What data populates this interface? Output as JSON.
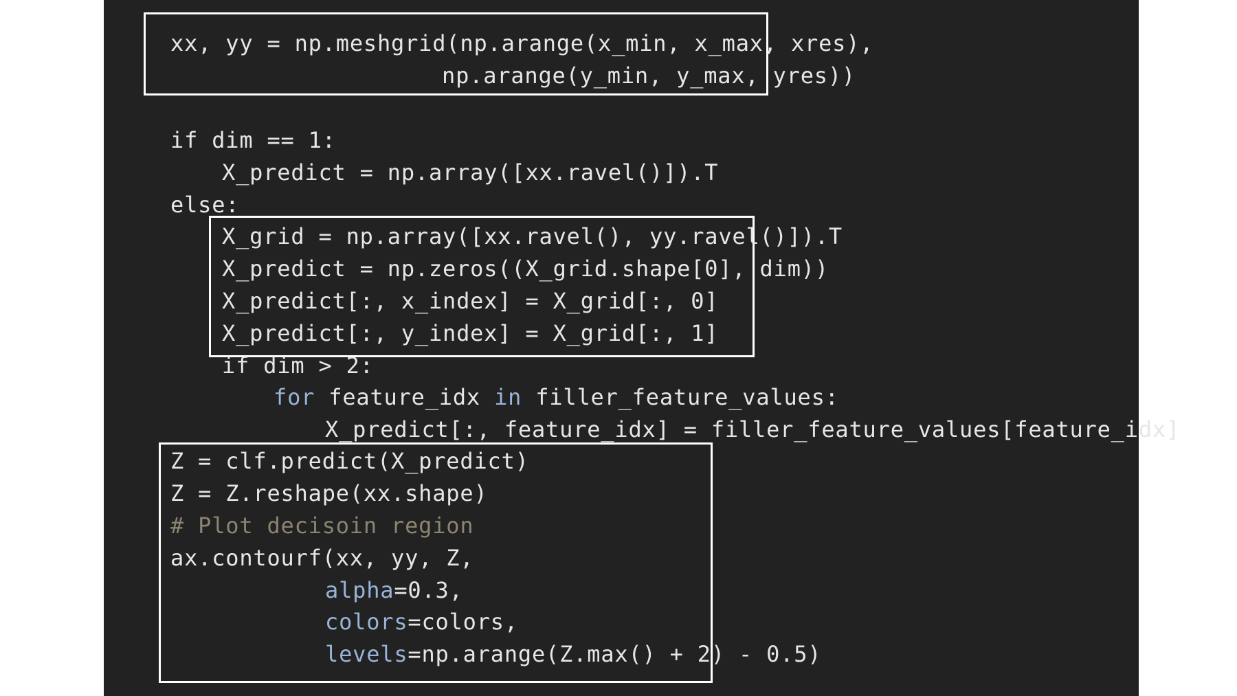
{
  "colors": {
    "background": "#222222",
    "text": "#e6e6e6",
    "keyword": "#98b4d8",
    "comment": "#8a8470",
    "box_border": "#ffffff",
    "page": "#ffffff"
  },
  "code": {
    "line_1": "xx, yy = np.meshgrid(np.arange(x_min, x_max, xres),",
    "line_2": "np.arange(y_min, y_max, yres))",
    "line_3": {
      "a": "if dim == 1:"
    },
    "line_4": "X_predict = np.array([xx.ravel()]).T",
    "line_5": "else:",
    "line_6": "X_grid = np.array([xx.ravel(), yy.ravel()]).T",
    "line_7": "X_predict = np.zeros((X_grid.shape[0], dim))",
    "line_8": "X_predict[:, x_index] = X_grid[:, 0]",
    "line_9": "X_predict[:, y_index] = X_grid[:, 1]",
    "line_10": "if dim > 2:",
    "line_11": {
      "kw_for": "for",
      "var": " feature_idx ",
      "kw_in": "in",
      "rest": " filler_feature_values:"
    },
    "line_12": "X_predict[:, feature_idx] = filler_feature_values[feature_idx]",
    "line_13": "Z = clf.predict(X_predict)",
    "line_14": "Z = Z.reshape(xx.shape)",
    "line_15": "# Plot decisoin region",
    "line_16": "ax.contourf(xx, yy, Z,",
    "line_17": {
      "param": "alpha",
      "rest": "=0.3,"
    },
    "line_18": {
      "param": "colors",
      "rest": "=colors,"
    },
    "line_19": {
      "param": "levels",
      "rest": "=np.arange(Z.max() + 2) - 0.5)"
    }
  }
}
